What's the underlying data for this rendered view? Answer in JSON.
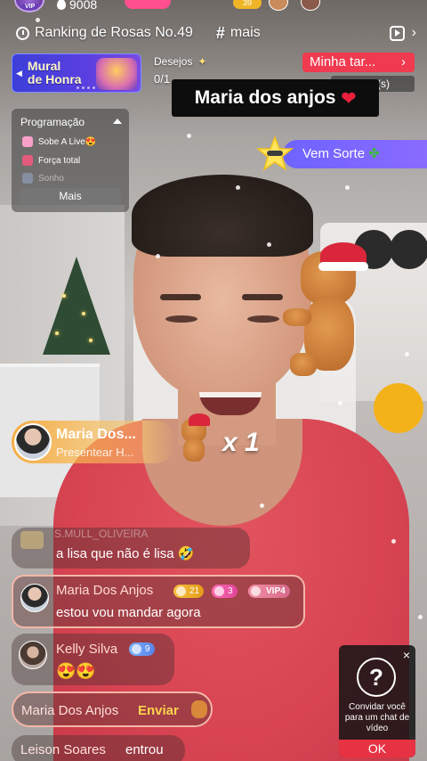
{
  "status": {
    "coins": "9008",
    "vip_tag": "VIP",
    "badge_level": "39"
  },
  "header": {
    "ranking": "Ranking de Rosas No.49",
    "more": "mais"
  },
  "mural": {
    "title_line1": "Mural",
    "title_line2": "de Honra"
  },
  "desejos": {
    "label": "Desejos",
    "value": "0/1"
  },
  "minha": {
    "label": "Minha tar...",
    "sub": "(s)"
  },
  "banner": {
    "name": "Maria dos anjos"
  },
  "programacao": {
    "title": "Programação",
    "items": [
      "Sobe A Live😍",
      "Força total",
      "Sonho"
    ],
    "more_button": "Mais"
  },
  "vem_sorte": {
    "label": "Vem Sorte"
  },
  "gift": {
    "sender": "Maria Dos...",
    "action": "Presentear H...",
    "count": "x 1"
  },
  "chat": [
    {
      "faded_name": "S.MULL_OLIVEIRA",
      "text": "a lisa que não é lisa 🤣"
    },
    {
      "name": "Maria Dos Anjos",
      "level": "21",
      "rank": "3",
      "vip": "VIP4",
      "text": "estou vou mandar agora"
    },
    {
      "name": "Kelly Silva",
      "level": "9",
      "text": "😍😍"
    },
    {
      "name": "Maria Dos Anjos",
      "action": "Enviar"
    },
    {
      "name": "Leison Soares",
      "action": "entrou"
    }
  ],
  "invite": {
    "text": "Convidar você para um chat de vídeo",
    "ok": "OK",
    "close": "×",
    "icon": "?"
  },
  "colors": {
    "accent_red": "#f03a4f",
    "mural_blue": "#3c3fd8",
    "sorte_purple": "#7a68ff",
    "shirt": "#d84452"
  }
}
